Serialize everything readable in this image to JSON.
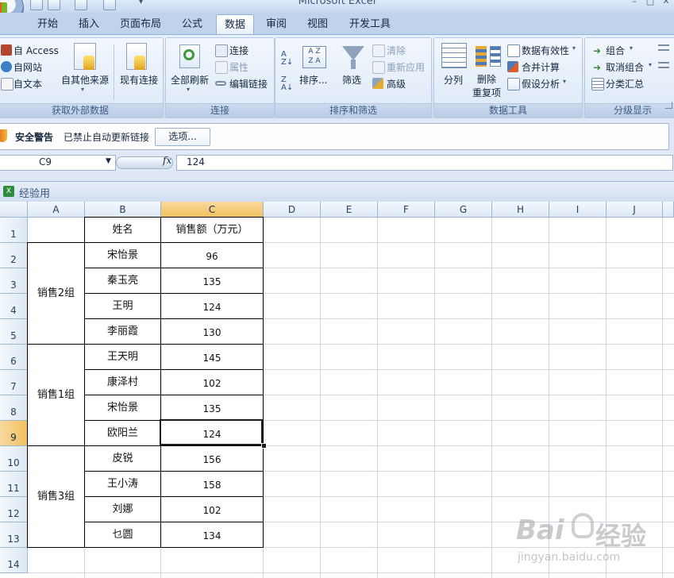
{
  "app": {
    "title": "Microsoft Excel"
  },
  "tabs": [
    {
      "label": "开始"
    },
    {
      "label": "插入"
    },
    {
      "label": "页面布局"
    },
    {
      "label": "公式"
    },
    {
      "label": "数据",
      "active": true
    },
    {
      "label": "审阅"
    },
    {
      "label": "视图"
    },
    {
      "label": "开发工具"
    }
  ],
  "ribbon": {
    "get_external": {
      "from_access": "自 Access",
      "from_web": "自网站",
      "from_text": "自文本",
      "other_sources": "自其他来源",
      "existing_conn": "现有连接",
      "label": "获取外部数据"
    },
    "connections": {
      "refresh_all": "全部刷新",
      "connections": "连接",
      "properties": "属性",
      "edit_links": "编辑链接",
      "label": "连接"
    },
    "sort_filter": {
      "sort": "排序...",
      "filter": "筛选",
      "clear": "清除",
      "reapply": "重新应用",
      "advanced": "高级",
      "label": "排序和筛选"
    },
    "data_tools": {
      "text_to_columns": "分列",
      "remove_dup_1": "删除",
      "remove_dup_2": "重复项",
      "validation": "数据有效性",
      "consolidate": "合并计算",
      "what_if": "假设分析",
      "label": "数据工具"
    },
    "outline": {
      "group": "组合",
      "ungroup": "取消组合",
      "subtotal": "分类汇总",
      "label": "分级显示"
    }
  },
  "security": {
    "title": "安全警告",
    "message": "已禁止自动更新链接",
    "options_button": "选项..."
  },
  "formula_bar": {
    "cell_ref": "C9",
    "fx": "fx",
    "value": "124"
  },
  "workbook": {
    "title": "经验用"
  },
  "sheet": {
    "columns": [
      "A",
      "B",
      "C",
      "D",
      "E",
      "F",
      "G",
      "H",
      "I",
      "J"
    ],
    "selected_column": "C",
    "rows": [
      "1",
      "2",
      "3",
      "4",
      "5",
      "6",
      "7",
      "8",
      "9",
      "10",
      "11",
      "12",
      "13",
      "14"
    ],
    "selected_row": "9",
    "header": {
      "name": "姓名",
      "sales": "销售额（万元）"
    },
    "groups": [
      {
        "label": "销售2组"
      },
      {
        "label": "销售1组"
      },
      {
        "label": "销售3组"
      }
    ],
    "records": [
      {
        "name": "宋怡景",
        "sales": "96"
      },
      {
        "name": "秦玉亮",
        "sales": "135"
      },
      {
        "name": "王明",
        "sales": "124"
      },
      {
        "name": "李丽霞",
        "sales": "130"
      },
      {
        "name": "王天明",
        "sales": "145"
      },
      {
        "name": "康泽村",
        "sales": "102"
      },
      {
        "name": "宋怡景",
        "sales": "135"
      },
      {
        "name": "欧阳兰",
        "sales": "124"
      },
      {
        "name": "皮锐",
        "sales": "156"
      },
      {
        "name": "王小涛",
        "sales": "158"
      },
      {
        "name": "刘娜",
        "sales": "102"
      },
      {
        "name": "乜圆",
        "sales": "134"
      }
    ]
  },
  "watermark": {
    "line1": "Bai",
    "line2": "经验",
    "line3": "jingyan.baidu.com"
  },
  "colors": {
    "selection_header": "#f1c15f",
    "ribbon_bg": "#dbe7f5",
    "grid_line": "#d0d7e5"
  }
}
